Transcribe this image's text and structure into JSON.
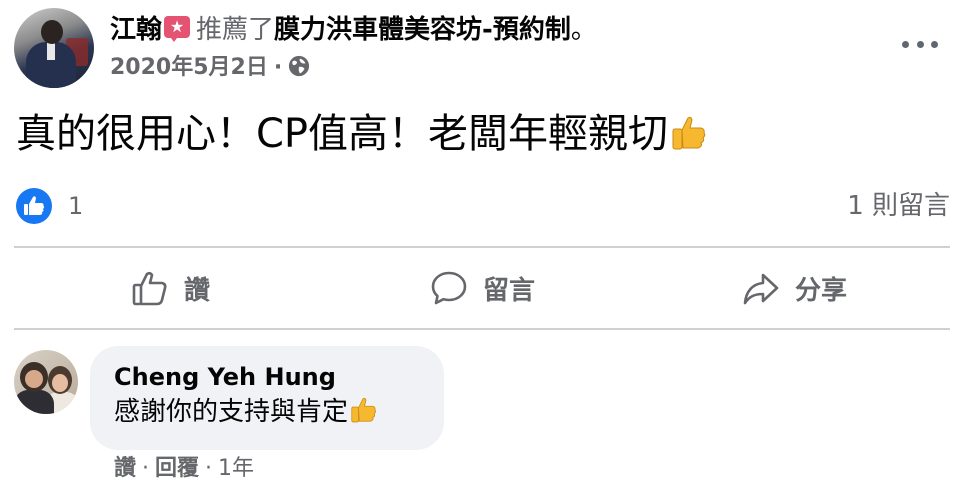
{
  "post": {
    "author": "江翰",
    "action": "推薦了",
    "page": "膜力洪車體美容坊-預約制",
    "period": "。",
    "date": "2020年5月2日",
    "meta_separator": "·",
    "privacy_icon": "globe-icon",
    "more_icon": "more-options-icon",
    "text": "真的很用心！CP值高！老闆年輕親切",
    "text_emoji": "thumbs-up-emoji"
  },
  "reactions": {
    "like_count": "1",
    "comment_count": "1 則留言"
  },
  "actions": {
    "like_label": "讚",
    "comment_label": "留言",
    "share_label": "分享"
  },
  "comment": {
    "author": "Cheng Yeh Hung",
    "text": "感謝你的支持與肯定",
    "text_emoji": "thumbs-up-emoji",
    "like_label": "讚",
    "reply_label": "回覆",
    "time": "1年",
    "separator": "·"
  },
  "colors": {
    "facebook_blue": "#1877f2",
    "secondary_text": "#65676b",
    "bubble_bg": "#f0f2f5",
    "divider": "#ced0d4",
    "badge_pink": "#e45472"
  }
}
